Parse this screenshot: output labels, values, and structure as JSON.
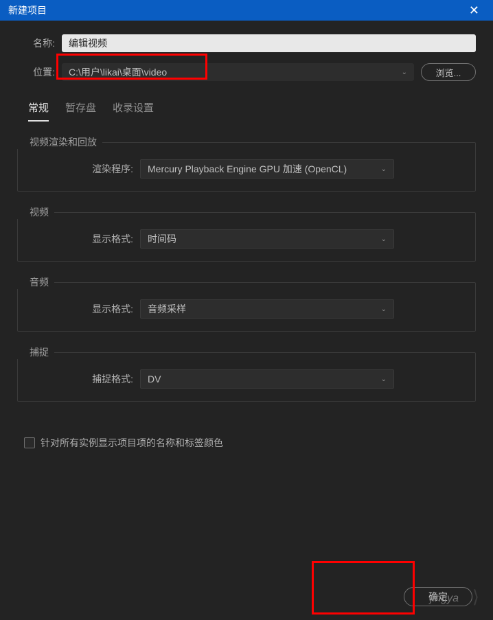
{
  "titlebar": {
    "title": "新建项目"
  },
  "form": {
    "name_label": "名称:",
    "name_value": "编辑视频",
    "location_label": "位置:",
    "location_value": "C:\\用户\\likai\\桌面\\video",
    "browse_label": "浏览..."
  },
  "tabs": {
    "general": "常规",
    "scratch": "暂存盘",
    "ingest": "收录设置"
  },
  "sections": {
    "video_render": {
      "title": "视频渲染和回放",
      "renderer_label": "渲染程序:",
      "renderer_value": "Mercury Playback Engine GPU 加速 (OpenCL)"
    },
    "video": {
      "title": "视频",
      "format_label": "显示格式:",
      "format_value": "时间码"
    },
    "audio": {
      "title": "音频",
      "format_label": "显示格式:",
      "format_value": "音频采样"
    },
    "capture": {
      "title": "捕捉",
      "format_label": "捕捉格式:",
      "format_value": "DV"
    }
  },
  "checkbox": {
    "label": "针对所有实例显示项目项的名称和标签颜色"
  },
  "footer": {
    "confirm": "确定"
  },
  "watermark": "jingya"
}
